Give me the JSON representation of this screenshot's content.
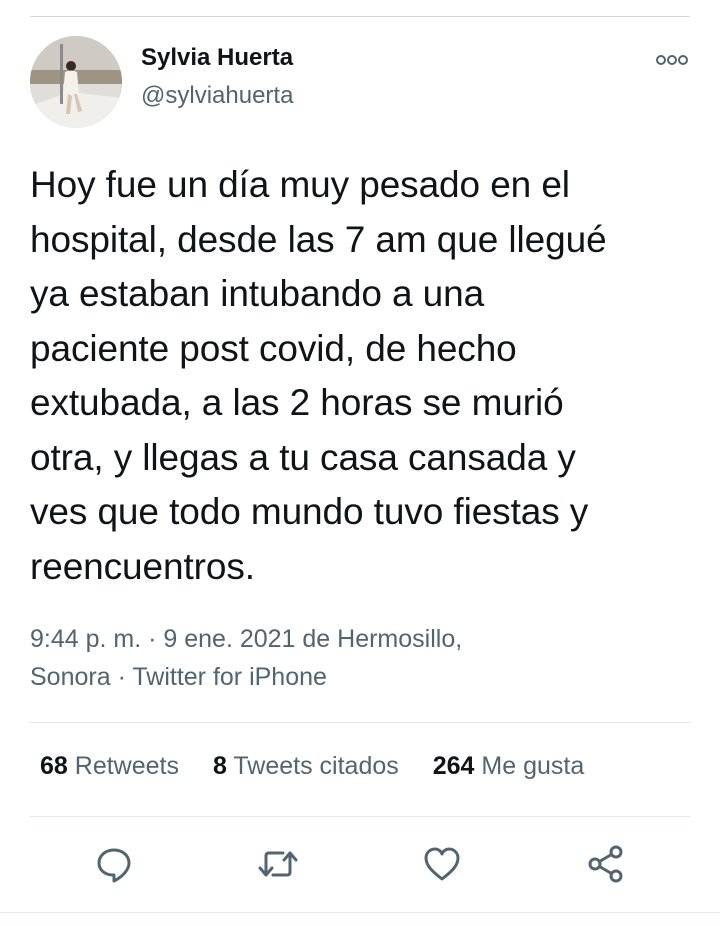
{
  "tweet": {
    "author_name": "Sylvia Huerta",
    "author_handle": "@sylviahuerta",
    "text": "Hoy fue un día muy pesado en el\nhospital, desde las 7 am que llegué\nya estaban intubando a una\npaciente post covid, de hecho\nextubada, a las 2 horas se murió\notra, y llegas a tu casa cansada y\nves que todo mundo tuvo fiestas y\nreencuentros.",
    "meta_line1": "9:44 p. m. · 9 ene. 2021 de Hermosillo,",
    "meta_place_end": "Sonora",
    "meta_sep": " · ",
    "meta_client": "Twitter for iPhone"
  },
  "stats": {
    "retweets_count": "68",
    "retweets_label": "Retweets",
    "quotes_count": "8",
    "quotes_label": "Tweets citados",
    "likes_count": "264",
    "likes_label": "Me gusta"
  },
  "icons": {
    "more": "more-options-icon",
    "reply": "reply-icon",
    "retweet": "retweet-icon",
    "like": "heart-icon",
    "share": "share-icon"
  },
  "colors": {
    "text": "#0f1419",
    "secondary": "#536471",
    "divider": "#e1e8ed"
  }
}
